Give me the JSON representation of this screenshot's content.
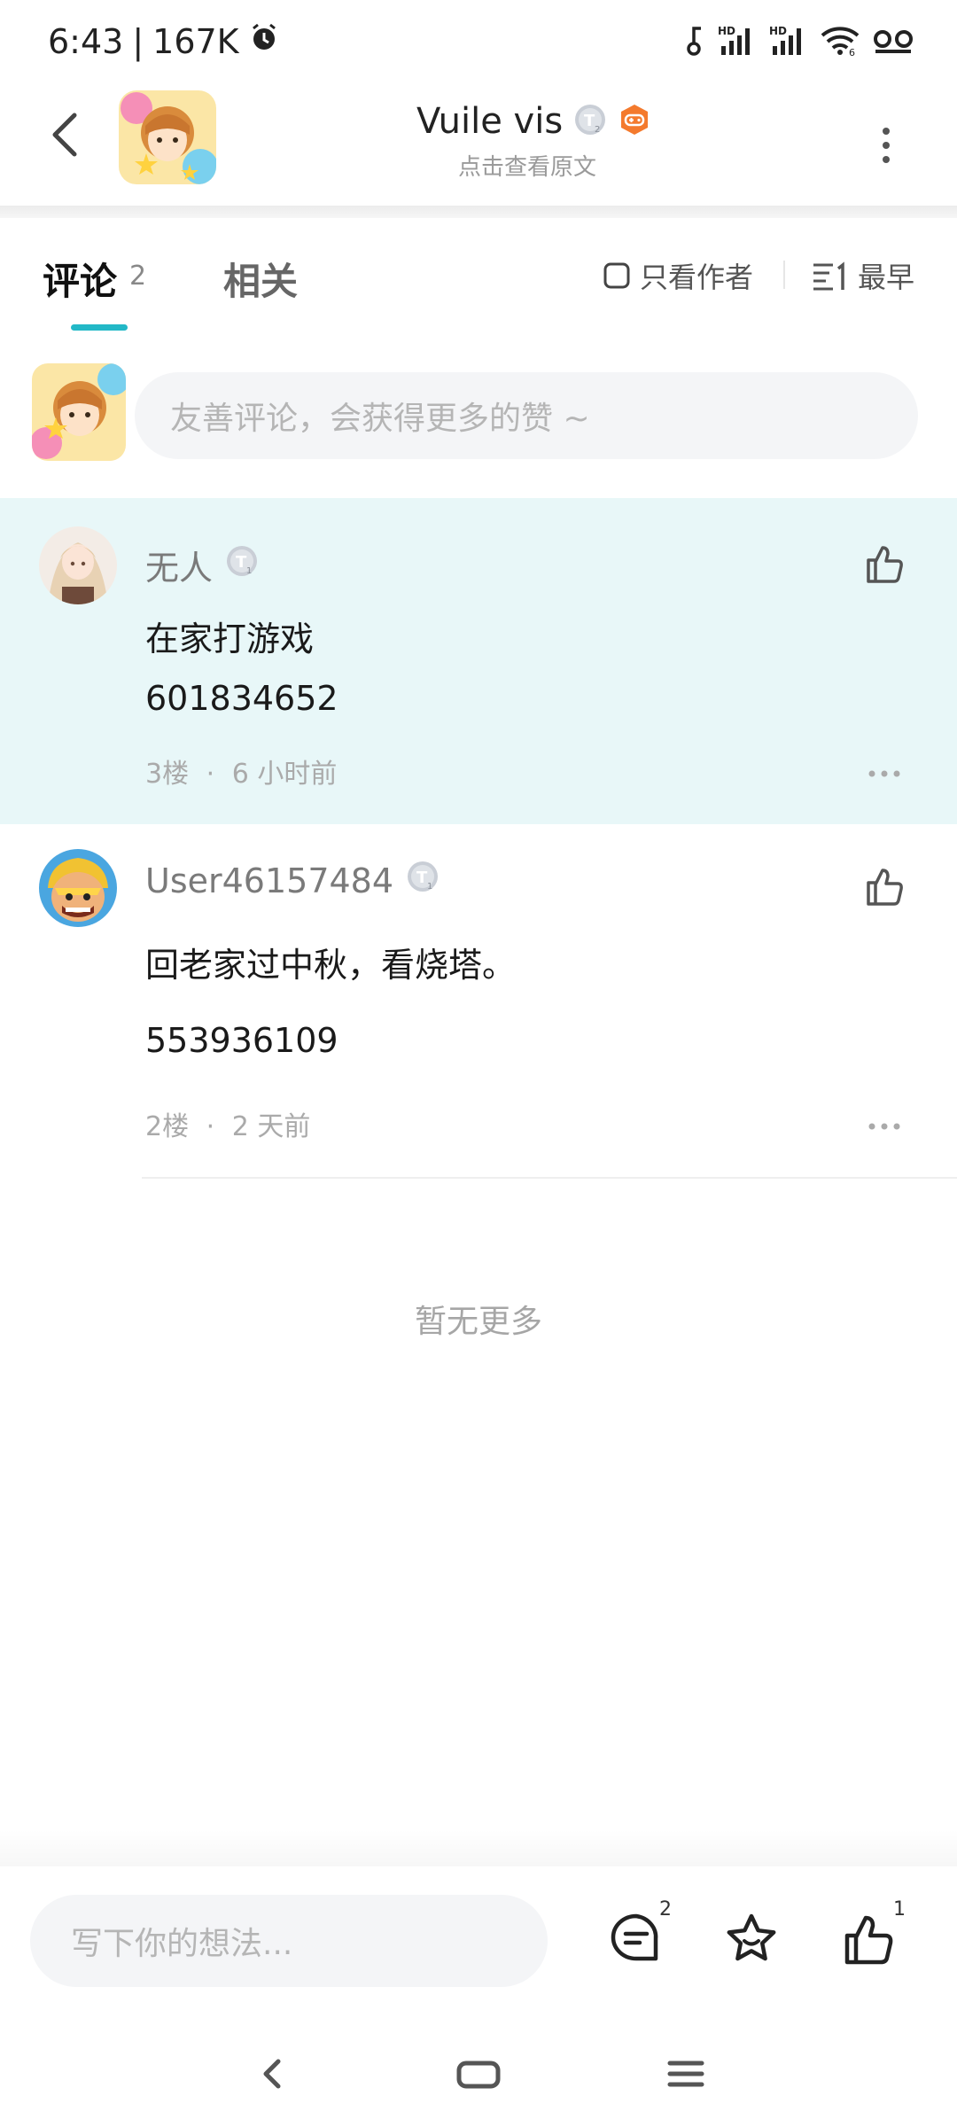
{
  "status_bar": {
    "time": "6:43",
    "separator": "|",
    "net_speed": "167K",
    "icons": [
      "alarm-icon",
      "key-icon",
      "signal-hd-icon",
      "signal-hd-icon",
      "wifi-icon",
      "voicemail-icon"
    ]
  },
  "header": {
    "author_name": "Vuile vis",
    "level_badge": "T",
    "subtitle": "点击查看原文"
  },
  "tabs": {
    "comments_label": "评论",
    "comments_count": "2",
    "related_label": "相关",
    "author_only_label": "只看作者",
    "sort_label": "最早",
    "accent_color": "#22b8c7"
  },
  "composer": {
    "placeholder": "友善评论，会获得更多的赞 ~"
  },
  "comments": [
    {
      "username": "无人",
      "level_badge": "T",
      "lines": [
        "在家打游戏",
        "601834652"
      ],
      "floor": "3楼",
      "dot": "·",
      "time": "6 小时前",
      "highlighted": true,
      "highlight_color": "#e8f7f8"
    },
    {
      "username": "User46157484",
      "level_badge": "T",
      "lines": [
        "回老家过中秋，看烧塔。",
        "553936109"
      ],
      "floor": "2楼",
      "dot": "·",
      "time": "2 天前",
      "highlighted": false
    }
  ],
  "no_more_text": "暂无更多",
  "bottom_bar": {
    "reply_placeholder": "写下你的想法...",
    "comment_count": "2",
    "like_count": "1"
  }
}
